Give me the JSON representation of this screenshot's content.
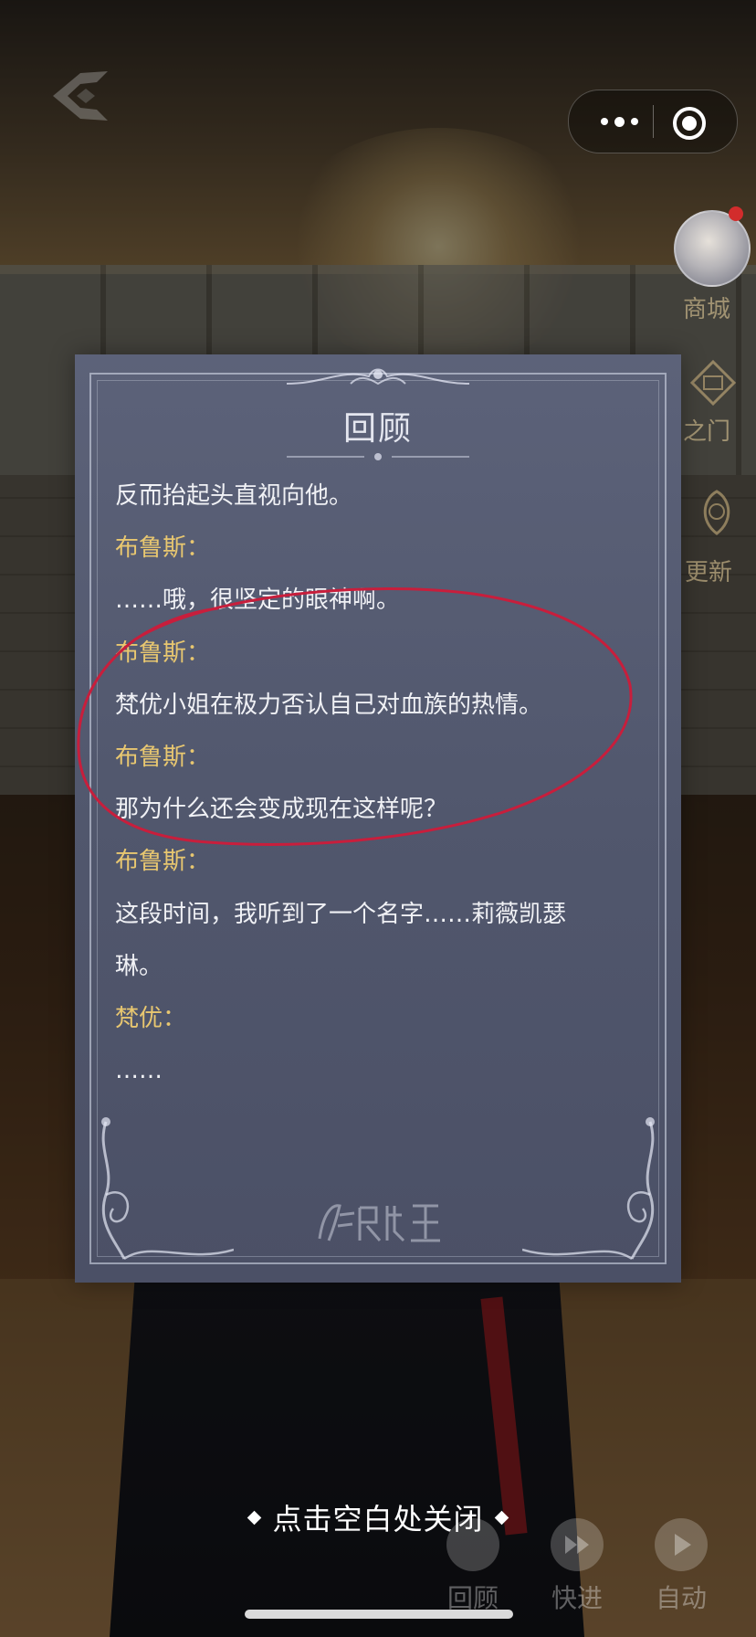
{
  "dialog": {
    "title": "回顾",
    "entries": [
      {
        "type": "line",
        "text": "反而抬起头直视向他。"
      },
      {
        "type": "speaker",
        "text": "布鲁斯："
      },
      {
        "type": "line",
        "text": "……哦，很坚定的眼神啊。"
      },
      {
        "type": "speaker",
        "text": "布鲁斯："
      },
      {
        "type": "line",
        "text": "梵优小姐在极力否认自己对血族的热情。"
      },
      {
        "type": "speaker",
        "text": "布鲁斯："
      },
      {
        "type": "line",
        "text": "那为什么还会变成现在这样呢？"
      },
      {
        "type": "speaker",
        "text": "布鲁斯："
      },
      {
        "type": "line",
        "text": "这段时间，我听到了一个名字……莉薇凯瑟"
      },
      {
        "type": "line",
        "text": "琳。"
      },
      {
        "type": "speaker",
        "text": "梵优："
      },
      {
        "type": "line",
        "text": "……"
      }
    ],
    "brand": "月影别墅"
  },
  "close_hint": "点击空白处关闭",
  "side_menu": {
    "shop": "商城",
    "gate": "之门",
    "update": "更新"
  },
  "controls": {
    "review": "回顾",
    "fast_forward": "快进",
    "auto": "自动"
  },
  "colors": {
    "speaker": "#e8c770",
    "text": "#f0f1f5",
    "panel": "#555b72",
    "annotation": "#c81e3c"
  }
}
